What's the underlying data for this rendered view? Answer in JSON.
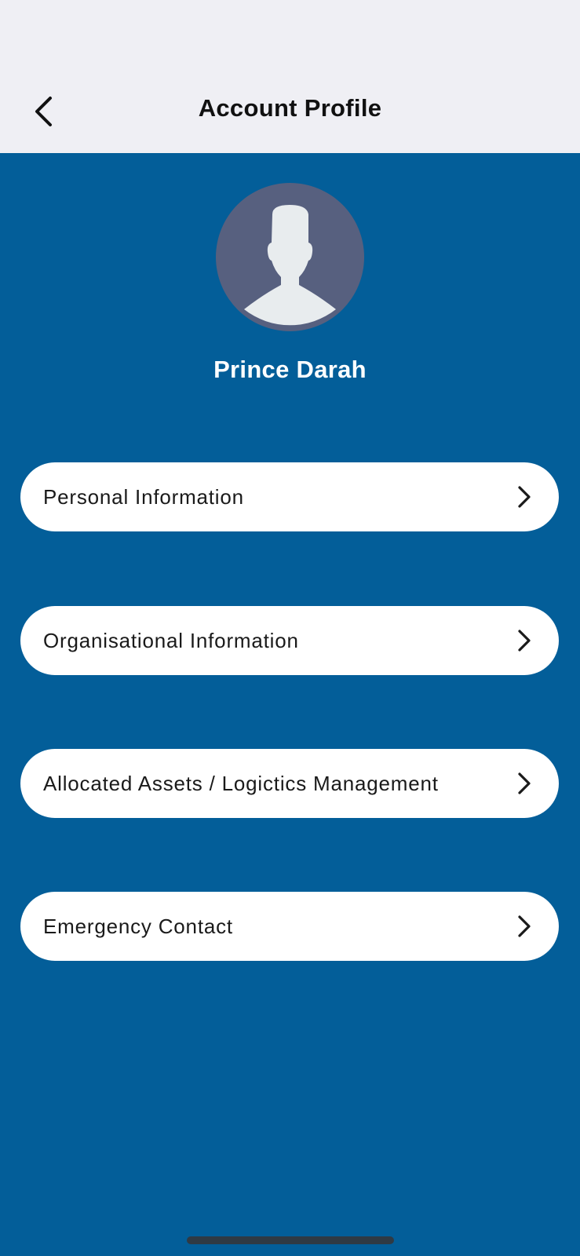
{
  "header": {
    "title": "Account Profile",
    "back_icon": "chevron-left-icon"
  },
  "profile": {
    "name": "Prince Darah",
    "avatar_icon": "person-silhouette-icon"
  },
  "menu": {
    "items": [
      {
        "label": "Personal Information",
        "icon": "chevron-right-icon"
      },
      {
        "label": "Organisational Information",
        "icon": "chevron-right-icon"
      },
      {
        "label": "Allocated Assets / Logictics Management",
        "icon": "chevron-right-icon"
      },
      {
        "label": "Emergency Contact",
        "icon": "chevron-right-icon"
      }
    ]
  },
  "colors": {
    "header_bg": "#efeff4",
    "main_bg": "#035e99",
    "card_bg": "#ffffff",
    "avatar_bg": "#57607f",
    "avatar_fg": "#e8ecee"
  }
}
